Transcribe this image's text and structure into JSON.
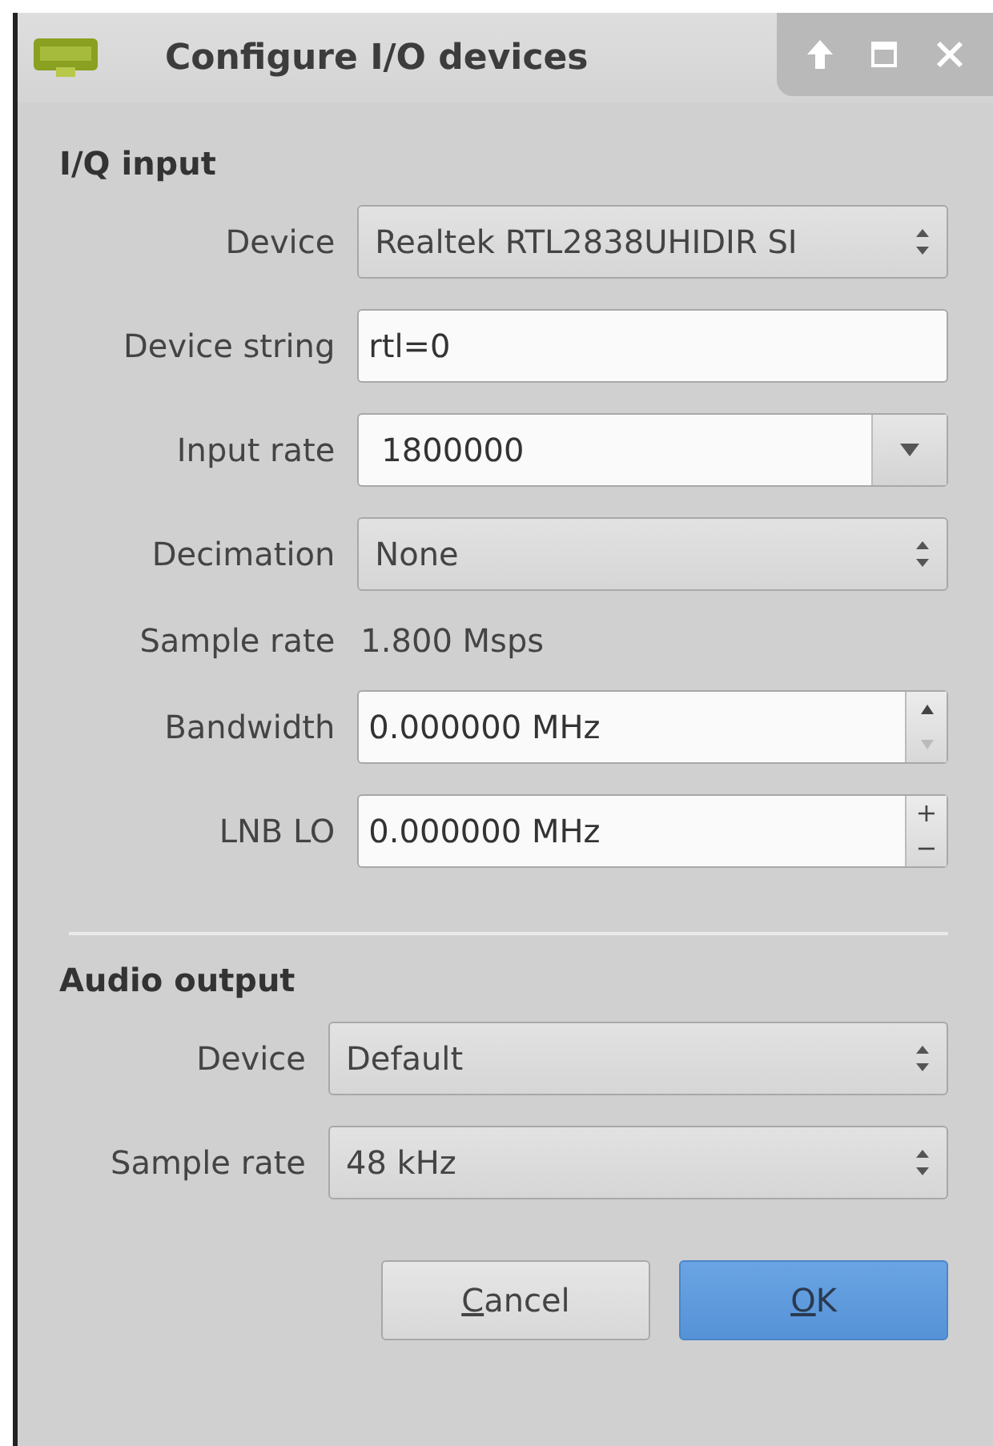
{
  "window": {
    "title": "Configure I/O devices"
  },
  "sections": [
    {
      "heading": "I/Q input",
      "rows": [
        {
          "label": "Device",
          "kind": "combo",
          "value": "Realtek RTL2838UHIDIR SI"
        },
        {
          "label": "Device string",
          "kind": "text",
          "value": "rtl=0"
        },
        {
          "label": "Input rate",
          "kind": "editable_combo",
          "value": "1800000"
        },
        {
          "label": "Decimation",
          "kind": "combo",
          "value": "None"
        },
        {
          "label": "Sample rate",
          "kind": "static",
          "value": "1.800 Msps"
        },
        {
          "label": "Bandwidth",
          "kind": "spin",
          "value": "0.000000 MHz",
          "up_disabled": false,
          "down_disabled": true
        },
        {
          "label": "LNB LO",
          "kind": "spin",
          "value": "0.000000 MHz",
          "up_text": "+",
          "down_text": "−",
          "up_disabled": false,
          "down_disabled": false
        }
      ]
    },
    {
      "heading": "Audio output",
      "rows": [
        {
          "label": "Device",
          "kind": "combo",
          "value": "Default"
        },
        {
          "label": "Sample rate",
          "kind": "combo",
          "value": "48 kHz"
        }
      ]
    }
  ],
  "buttons": [
    {
      "label": "Cancel",
      "first_letter_underlined": true,
      "default": false
    },
    {
      "label": "OK",
      "first_letter_underlined": true,
      "default": true
    }
  ]
}
